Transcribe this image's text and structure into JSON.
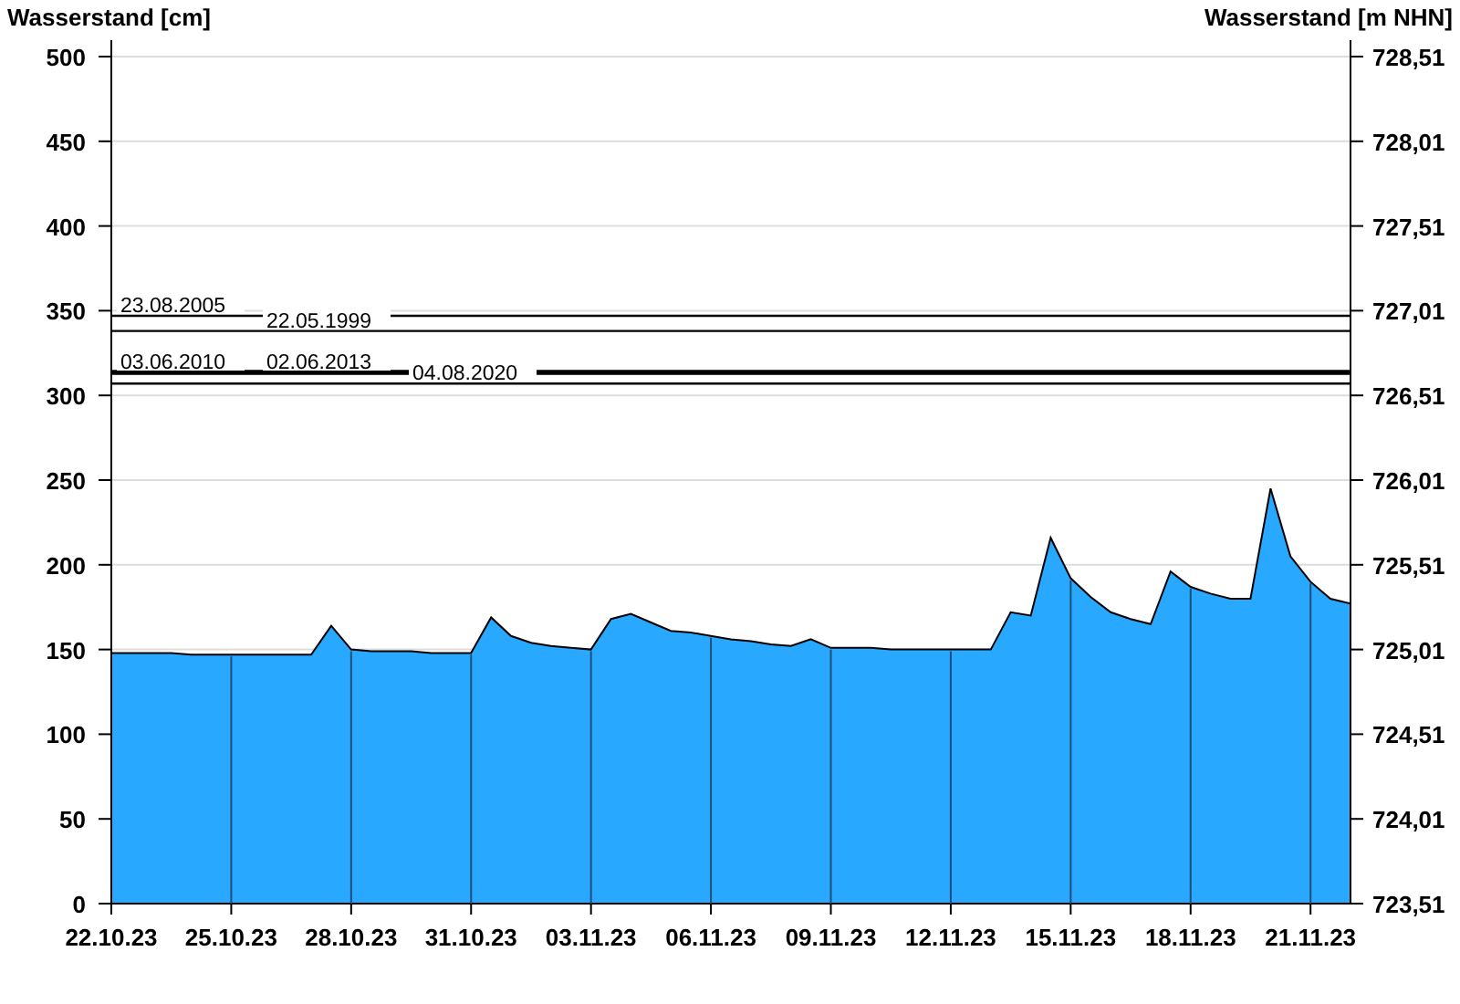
{
  "chart_data": {
    "type": "area",
    "ylabel": "Wasserstand [cm]",
    "categories": [
      "22.10.23",
      null,
      null,
      null,
      null,
      null,
      "25.10.23",
      null,
      null,
      null,
      null,
      null,
      "28.10.23",
      null,
      null,
      null,
      null,
      null,
      "31.10.23",
      null,
      null,
      null,
      null,
      null,
      "03.11.23",
      null,
      null,
      null,
      null,
      null,
      "06.11.23",
      null,
      null,
      null,
      null,
      null,
      "09.11.23",
      null,
      null,
      null,
      null,
      null,
      "12.11.23",
      null,
      null,
      null,
      null,
      null,
      "15.11.23",
      null,
      null,
      null,
      null,
      null,
      "18.11.23",
      null,
      null,
      null,
      null,
      null,
      "21.11.23",
      null,
      null
    ],
    "series": [
      {
        "color": "#29a8ff",
        "values": [
          148,
          148,
          148,
          148,
          147,
          147,
          147,
          147,
          147,
          147,
          147,
          164,
          150,
          149,
          149,
          149,
          148,
          148,
          148,
          169,
          158,
          154,
          152,
          151,
          150,
          168,
          171,
          166,
          161,
          160,
          158,
          156,
          155,
          153,
          152,
          156,
          151,
          151,
          151,
          150,
          150,
          150,
          150,
          150,
          150,
          172,
          170,
          216,
          192,
          181,
          172,
          168,
          165,
          196,
          187,
          183,
          180,
          180,
          245,
          205,
          190,
          180,
          177
        ]
      }
    ],
    "ylim": [
      0,
      500
    ],
    "grid": true,
    "yticks": [
      0,
      50,
      100,
      150,
      200,
      250,
      300,
      350,
      400,
      450,
      500
    ]
  },
  "flood_marks": [
    {
      "label": "23.08.2005"
    },
    {
      "label": "22.05.1999"
    },
    {
      "label": "03.06.2010"
    },
    {
      "label": "02.06.2013"
    },
    {
      "label": "04.08.2020"
    }
  ],
  "right_axis": {
    "title": "Wasserstand [m NHN]",
    "tick_labels": [
      "728,51",
      "728,01",
      "727,51",
      "727,01",
      "726,51",
      "726,01",
      "725,51",
      "725,01",
      "724,51",
      "724,01",
      "723,51"
    ]
  }
}
